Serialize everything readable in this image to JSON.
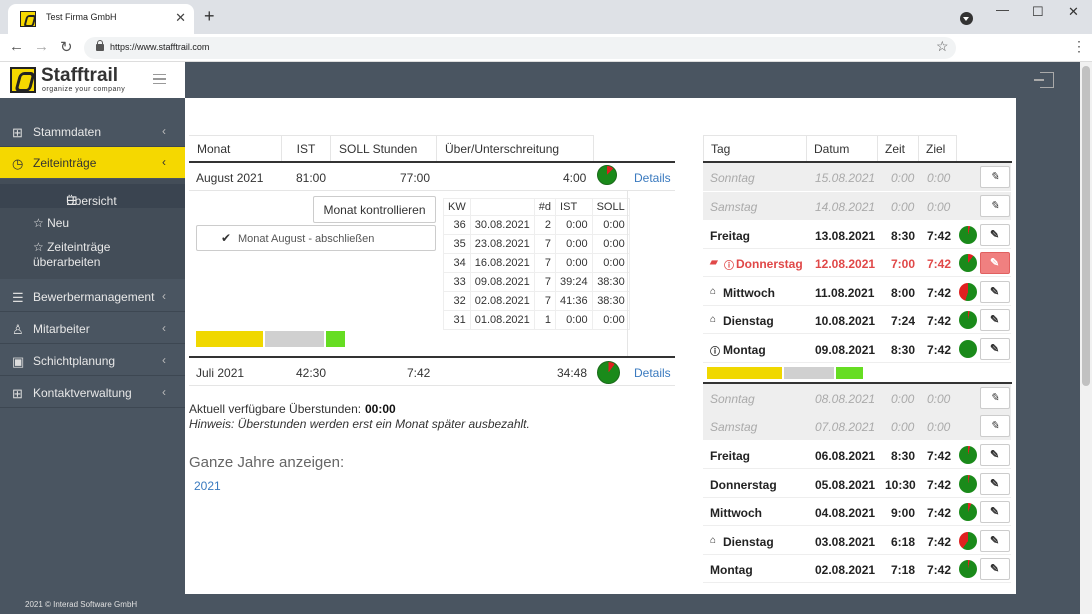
{
  "browser": {
    "tab_title": "Test Firma GmbH",
    "url": "https://www.stafftrail.com"
  },
  "app": {
    "brand": "Stafftrail",
    "slogan": "organize your company",
    "copyright": "2021 © Interad Software GmbH"
  },
  "sidebar": {
    "items": [
      {
        "label": "Stammdaten",
        "icon": "grid-icon"
      },
      {
        "label": "Zeiteinträge",
        "icon": "clock-icon"
      },
      {
        "label": "Bewerbermanagement",
        "icon": "list-icon"
      },
      {
        "label": "Mitarbeiter",
        "icon": "user-icon"
      },
      {
        "label": "Schichtplanung",
        "icon": "calendar-icon"
      },
      {
        "label": "Kontaktverwaltung",
        "icon": "grid-icon"
      }
    ],
    "sub": [
      "Übersicht",
      "Neu",
      "Zeiteinträge überarbeiten"
    ]
  },
  "months_table": {
    "headers": [
      "Monat",
      "IST",
      "SOLL Stunden",
      "Über/Unterschreitung"
    ],
    "rows": [
      {
        "month": "August 2021",
        "ist": "81:00",
        "soll": "77:00",
        "diff": "4:00",
        "link": "Details"
      },
      {
        "month": "Juli 2021",
        "ist": "42:30",
        "soll": "7:42",
        "diff": "34:48",
        "link": "Details"
      }
    ],
    "btn_control": "Monat kontrollieren",
    "btn_close": "Monat August - abschließen"
  },
  "kw_table": {
    "headers": [
      "KW",
      "",
      "#d",
      "IST",
      "SOLL"
    ],
    "rows": [
      [
        "36",
        "30.08.2021",
        "2",
        "0:00",
        "0:00"
      ],
      [
        "35",
        "23.08.2021",
        "7",
        "0:00",
        "0:00"
      ],
      [
        "34",
        "16.08.2021",
        "7",
        "0:00",
        "0:00"
      ],
      [
        "33",
        "09.08.2021",
        "7",
        "39:24",
        "38:30"
      ],
      [
        "32",
        "02.08.2021",
        "7",
        "41:36",
        "38:30"
      ],
      [
        "31",
        "01.08.2021",
        "1",
        "0:00",
        "0:00"
      ]
    ]
  },
  "overtime": {
    "label": "Aktuell verfügbare Überstunden:",
    "value": "00:00",
    "hint": "Hinweis: Überstunden werden erst ein Monat später ausbezahlt.",
    "years_title": "Ganze Jahre anzeigen:",
    "year_link": "2021"
  },
  "days_table": {
    "headers": [
      "Tag",
      "Datum",
      "Zeit",
      "Ziel"
    ],
    "week1": [
      {
        "day": "Sonntag",
        "date": "15.08.2021",
        "time": "0:00",
        "goal": "0:00",
        "style": "grey"
      },
      {
        "day": "Samstag",
        "date": "14.08.2021",
        "time": "0:00",
        "goal": "0:00",
        "style": "grey"
      },
      {
        "day": "Freitag",
        "date": "13.08.2021",
        "time": "8:30",
        "goal": "7:42",
        "style": "bold"
      },
      {
        "day": "Donnerstag",
        "date": "12.08.2021",
        "time": "7:00",
        "goal": "7:42",
        "style": "red"
      },
      {
        "day": "Mittwoch",
        "date": "11.08.2021",
        "time": "8:00",
        "goal": "7:42",
        "style": "bold"
      },
      {
        "day": "Dienstag",
        "date": "10.08.2021",
        "time": "7:24",
        "goal": "7:42",
        "style": "bold"
      },
      {
        "day": "Montag",
        "date": "09.08.2021",
        "time": "8:30",
        "goal": "7:42",
        "style": "bold"
      }
    ],
    "week2": [
      {
        "day": "Sonntag",
        "date": "08.08.2021",
        "time": "0:00",
        "goal": "0:00",
        "style": "grey"
      },
      {
        "day": "Samstag",
        "date": "07.08.2021",
        "time": "0:00",
        "goal": "0:00",
        "style": "grey"
      },
      {
        "day": "Freitag",
        "date": "06.08.2021",
        "time": "8:30",
        "goal": "7:42",
        "style": "bold"
      },
      {
        "day": "Donnerstag",
        "date": "05.08.2021",
        "time": "10:30",
        "goal": "7:42",
        "style": "bold"
      },
      {
        "day": "Mittwoch",
        "date": "04.08.2021",
        "time": "9:00",
        "goal": "7:42",
        "style": "bold"
      },
      {
        "day": "Dienstag",
        "date": "03.08.2021",
        "time": "6:18",
        "goal": "7:42",
        "style": "bold"
      },
      {
        "day": "Montag",
        "date": "02.08.2021",
        "time": "7:18",
        "goal": "7:42",
        "style": "bold"
      }
    ]
  },
  "colors": {
    "accent": "#f5d800",
    "sidebar": "#4a5561",
    "link": "#3a7abf",
    "alert": "#e04848",
    "pie_green": "#1a8a1a",
    "pie_red": "#e02020"
  }
}
